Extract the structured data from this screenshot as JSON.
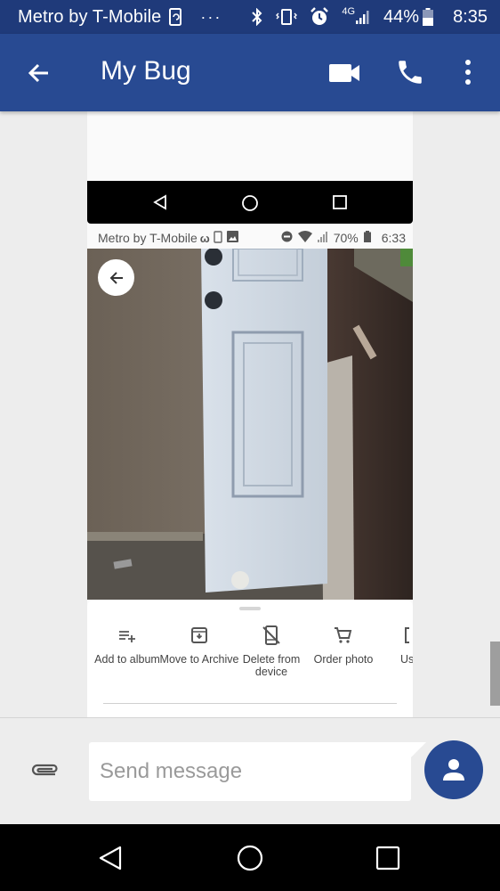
{
  "status_bar": {
    "carrier": "Metro by T-Mobile",
    "network": "4G",
    "battery": "44%",
    "battery_level": 0.44,
    "time": "8:35",
    "icons": [
      "sync-phone-icon",
      "more-notifications-icon",
      "bluetooth-icon",
      "vibrate-icon",
      "alarm-icon",
      "signal-icon",
      "battery-icon"
    ]
  },
  "app_bar": {
    "title": "My Bug",
    "back_icon": "arrow-back-icon",
    "actions": [
      "video-call-icon",
      "phone-icon",
      "more-vert-icon"
    ]
  },
  "message": {
    "embedded_screenshot": {
      "status_bar": {
        "carrier": "Metro by T-Mobile",
        "battery": "70%",
        "battery_level": 0.7,
        "time": "6:33"
      },
      "photo_description": "White door leaning against wall",
      "bottom_sheet": {
        "actions": [
          {
            "icon": "playlist-add-icon",
            "label": "Add to album"
          },
          {
            "icon": "archive-icon",
            "label": "Move to Archive"
          },
          {
            "icon": "phone-off-icon",
            "label": "Delete from device"
          },
          {
            "icon": "cart-icon",
            "label": "Order photo"
          },
          {
            "icon": "partial-icon",
            "label": "Us"
          }
        ]
      }
    }
  },
  "compose": {
    "placeholder": "Send message",
    "value": ""
  },
  "colors": {
    "status_bar_bg": "#1f3a7a",
    "app_bar_bg": "#284a92",
    "accent": "#284a92"
  }
}
